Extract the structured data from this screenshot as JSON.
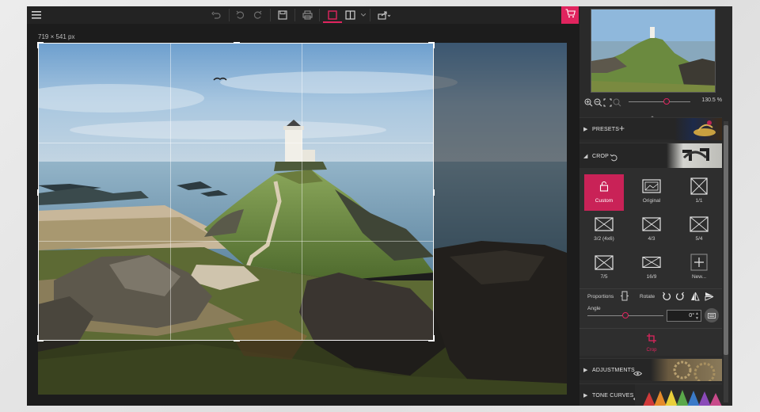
{
  "toolbar": {
    "icons": [
      "menu-icon",
      "undo-all-icon",
      "undo-icon",
      "redo-icon",
      "save-icon",
      "print-icon",
      "single-view-icon",
      "split-view-icon",
      "share-icon",
      "cart-icon"
    ]
  },
  "canvas": {
    "dimensions_label": "719 × 541 px"
  },
  "panel": {
    "zoom_value": "130.5 %",
    "sections": {
      "presets": "PRESETS",
      "crop": "CROP",
      "adjustments": "ADJUSTMENTS",
      "tone_curves": "TONE CURVES"
    },
    "crop": {
      "ratios": [
        {
          "label": "Custom"
        },
        {
          "label": "Original"
        },
        {
          "label": "1/1"
        },
        {
          "label": "3/2 (4x6)"
        },
        {
          "label": "4/3"
        },
        {
          "label": "5/4"
        },
        {
          "label": "7/5"
        },
        {
          "label": "16/9"
        },
        {
          "label": "New..."
        }
      ],
      "proportions_label": "Proportions",
      "rotate_label": "Rotate",
      "angle_label": "Angle",
      "angle_value": "0°",
      "crop_button_label": "Crop"
    }
  },
  "colors": {
    "accent": "#e0245e",
    "toolbar_bg": "#232323",
    "panel_bg": "#2a2a2a"
  }
}
